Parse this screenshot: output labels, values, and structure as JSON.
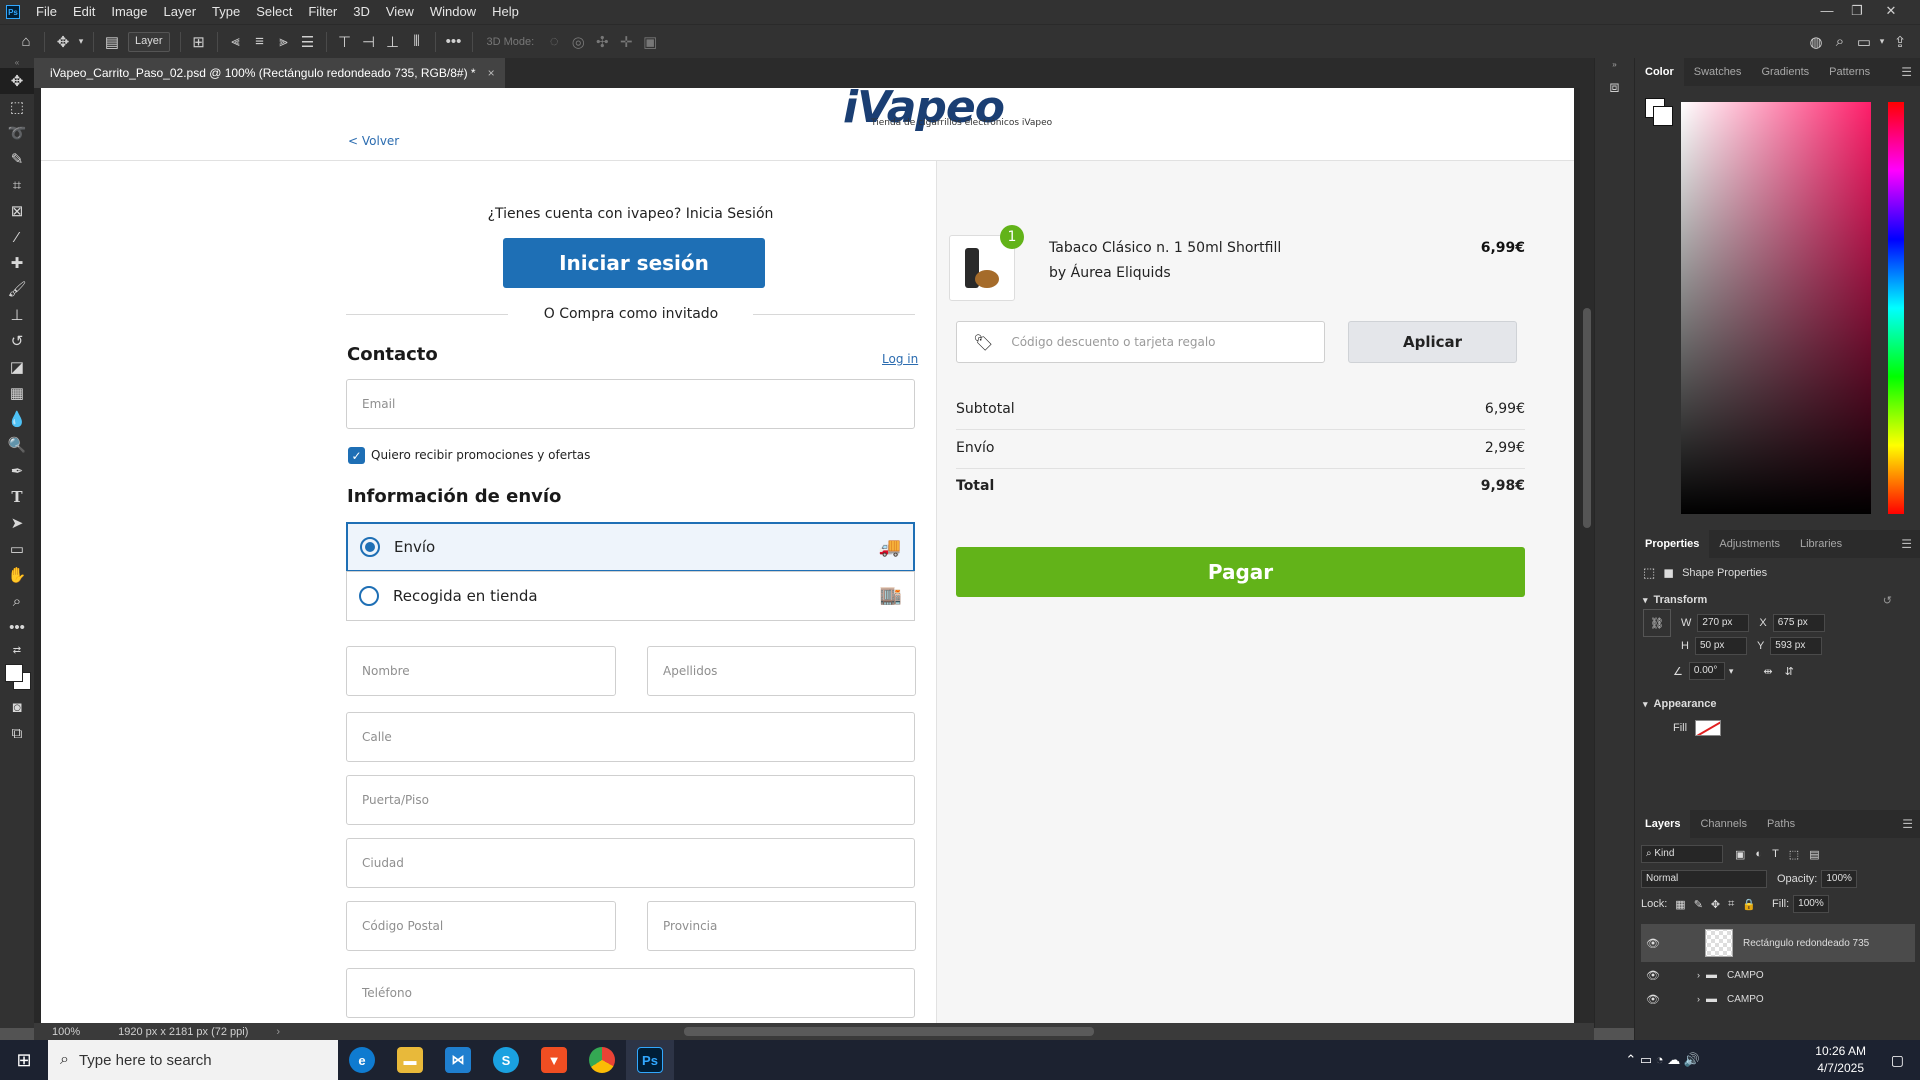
{
  "menubar": {
    "items": [
      "File",
      "Edit",
      "Image",
      "Layer",
      "Type",
      "Select",
      "Filter",
      "3D",
      "View",
      "Window",
      "Help"
    ]
  },
  "options_bar": {
    "layer_select": "Layer",
    "mode_3d": "3D Mode:"
  },
  "document_tab": {
    "title": "iVapeo_Carrito_Paso_02.psd @ 100% (Rectángulo redondeado 735, RGB/8#) *",
    "close": "×"
  },
  "status_bar": {
    "zoom": "100%",
    "doc_info": "1920 px x 2181 px (72 ppi)"
  },
  "panels": {
    "color_tabs": [
      "Color",
      "Swatches",
      "Gradients",
      "Patterns"
    ],
    "properties_tabs": [
      "Properties",
      "Adjustments",
      "Libraries"
    ],
    "shape_properties_label": "Shape Properties",
    "transform_label": "Transform",
    "w_label": "W",
    "w_value": "270 px",
    "x_label": "X",
    "x_value": "675 px",
    "h_label": "H",
    "h_value": "50 px",
    "y_label": "Y",
    "y_value": "593 px",
    "angle_value": "0.00°",
    "appearance_label": "Appearance",
    "fill_label": "Fill",
    "layers_tabs": [
      "Layers",
      "Channels",
      "Paths"
    ],
    "kind_label": "Kind",
    "blend_mode": "Normal",
    "opacity_label": "Opacity:",
    "opacity_value": "100%",
    "lock_label": "Lock:",
    "fill_pct_label": "Fill:",
    "fill_pct_value": "100%",
    "layers": [
      {
        "name": "Rectángulo redondeado 735"
      },
      {
        "name": "CAMPO"
      },
      {
        "name": "CAMPO"
      }
    ]
  },
  "taskbar": {
    "search_placeholder": "Type here to search",
    "time": "10:26 AM",
    "date": "4/7/2025"
  },
  "webpage": {
    "logo_word": "iVapeo",
    "logo_tagline": "Tienda de cigarrillos electrónicos iVapeo",
    "back_link": "< Volver",
    "account_prompt": "¿Tienes cuenta con ivapeo? Inicia Sesión",
    "login_button": "Iniciar sesión",
    "guest_text": "O Compra como invitado",
    "contact_heading": "Contacto",
    "login_link": "Log in",
    "email_placeholder": "Email",
    "promo_checkbox_label": "Quiero recibir promociones y ofertas",
    "shipping_heading": "Información de envío",
    "shipping_options": [
      {
        "label": "Envío",
        "selected": true,
        "icon": "truck-icon"
      },
      {
        "label": "Recogida en tienda",
        "selected": false,
        "icon": "store-icon"
      }
    ],
    "fields": {
      "nombre": "Nombre",
      "apellidos": "Apellidos",
      "calle": "Calle",
      "puerta": "Puerta/Piso",
      "ciudad": "Ciudad",
      "codigo_postal": "Código Postal",
      "provincia": "Provincia",
      "telefono": "Teléfono"
    },
    "cart": {
      "quantity_badge": "1",
      "product_name": "Tabaco Clásico n. 1  50ml Shortfill",
      "product_brand": "by Áurea Eliquids",
      "product_price": "6,99€",
      "discount_placeholder": "Código descuento o tarjeta regalo",
      "apply_button": "Aplicar",
      "subtotal_label": "Subtotal",
      "subtotal_value": "6,99€",
      "shipping_label": "Envío",
      "shipping_value": "2,99€",
      "total_label": "Total",
      "total_value": "9,98€",
      "pay_button": "Pagar"
    },
    "colors": {
      "primary_blue": "#1e6fb5",
      "pay_green": "#62b319"
    }
  }
}
